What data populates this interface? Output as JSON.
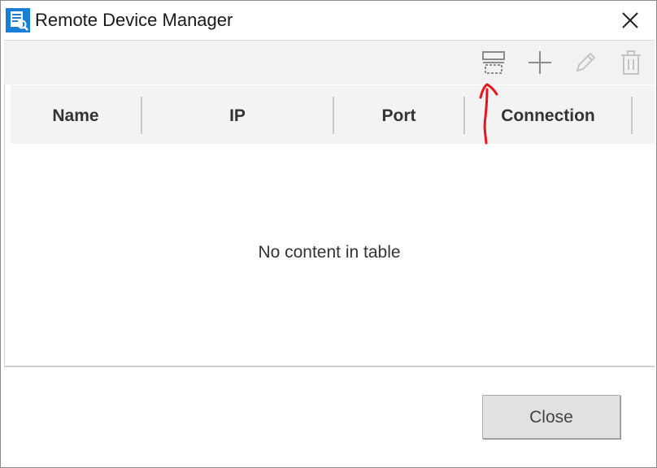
{
  "window": {
    "title": "Remote Device Manager"
  },
  "toolbar": {
    "icons": [
      "scan-icon",
      "add-icon",
      "edit-icon",
      "delete-icon"
    ]
  },
  "table": {
    "columns": [
      "Name",
      "IP",
      "Port",
      "Connection"
    ],
    "empty_message": "No content in table"
  },
  "footer": {
    "close_label": "Close"
  },
  "colors": {
    "accent": "#1976d2",
    "annotation": "#e8141b",
    "header_bg": "#f3f3f3",
    "toolbar_bg": "#f2f2f2"
  }
}
